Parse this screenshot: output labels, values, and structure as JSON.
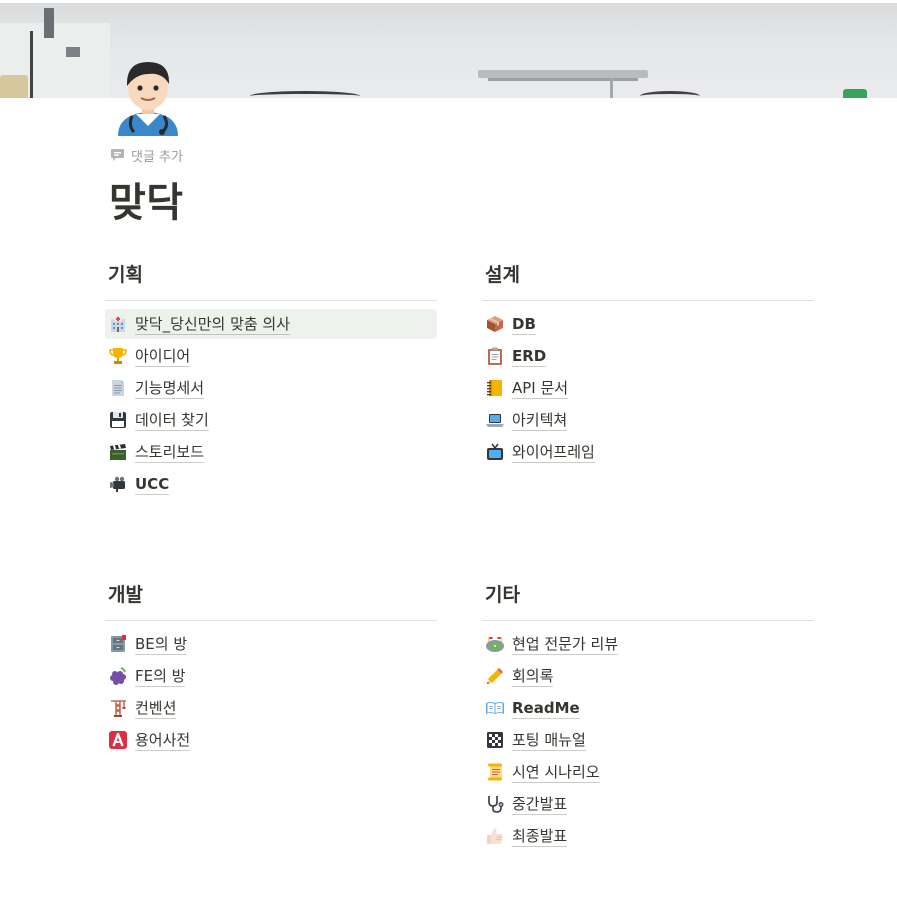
{
  "page": {
    "title": "맞닥",
    "add_comment_label": "댓글 추가",
    "icon": "doctor-avatar-icon"
  },
  "sections": {
    "planning": {
      "heading": "기획",
      "items": [
        {
          "label": "맞닥_당신만의 맞춤 의사",
          "icon": "hospital-icon"
        },
        {
          "label": "아이디어",
          "icon": "trophy-icon"
        },
        {
          "label": "기능명세서",
          "icon": "document-icon"
        },
        {
          "label": "데이터 찾기",
          "icon": "floppy-disk-icon"
        },
        {
          "label": "스토리보드",
          "icon": "clapper-board-icon"
        },
        {
          "label": "UCC",
          "icon": "video-camera-icon"
        }
      ]
    },
    "design": {
      "heading": "설계",
      "items": [
        {
          "label": "DB",
          "icon": "package-icon"
        },
        {
          "label": "ERD",
          "icon": "clipboard-icon"
        },
        {
          "label": "API 문서",
          "icon": "notebook-icon"
        },
        {
          "label": "아키텍쳐",
          "icon": "laptop-icon"
        },
        {
          "label": "와이어프레임",
          "icon": "television-icon"
        }
      ]
    },
    "development": {
      "heading": "개발",
      "items": [
        {
          "label": "BE의 방",
          "icon": "file-cabinet-icon"
        },
        {
          "label": "FE의 방",
          "icon": "grapes-icon"
        },
        {
          "label": "컨벤션",
          "icon": "construction-crane-icon"
        },
        {
          "label": "용어사전",
          "icon": "letter-a-icon"
        }
      ]
    },
    "etc": {
      "heading": "기타",
      "items": [
        {
          "label": "현업 전문가 리뷰",
          "icon": "stadium-icon"
        },
        {
          "label": "회의록",
          "icon": "pencil-icon"
        },
        {
          "label": "ReadMe",
          "icon": "open-book-icon"
        },
        {
          "label": "포팅 매뉴얼",
          "icon": "checkered-flag-icon"
        },
        {
          "label": "시연 시나리오",
          "icon": "scroll-icon"
        },
        {
          "label": "중간발표",
          "icon": "stethoscope-icon"
        },
        {
          "label": "최종발표",
          "icon": "thumbs-up-icon"
        }
      ]
    }
  },
  "colors": {
    "text": "#37352f",
    "muted": "#9b9a97",
    "highlight_row": "#edf3ec",
    "divider": "#e3e2e0"
  }
}
